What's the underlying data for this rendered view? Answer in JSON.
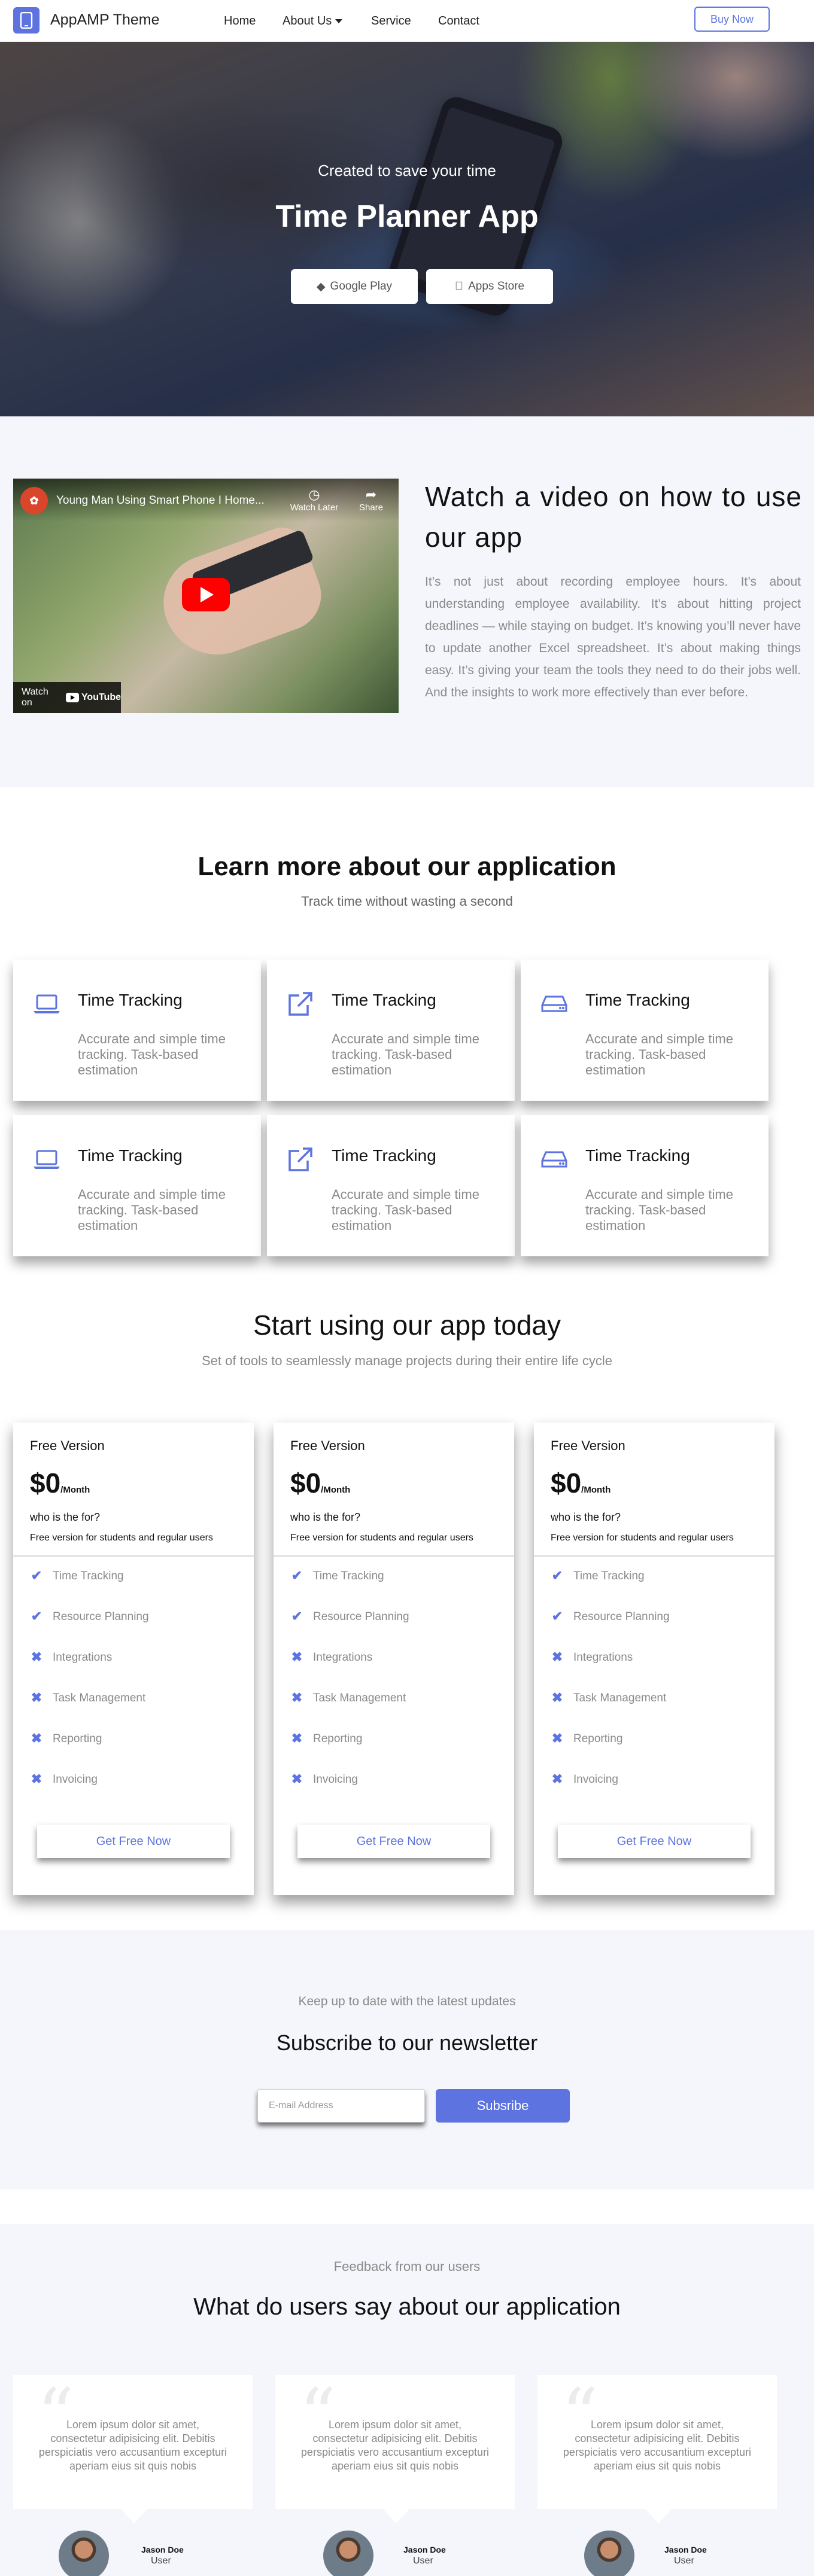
{
  "nav": {
    "logo": "AppAMP Theme",
    "links": [
      "Home",
      "About Us",
      "Service",
      "Contact"
    ],
    "buy": "Buy Now"
  },
  "hero": {
    "subtitle": "Created to save your time",
    "title": "Time Planner App",
    "google_play": "Google Play",
    "apps_store": "Apps Store"
  },
  "video": {
    "yt_title": "Young Man Using Smart Phone I Home...",
    "watch_later": "Watch Later",
    "share": "Share",
    "watch_on": "Watch on",
    "youtube": "YouTube",
    "heading": "Watch a video on how to use our app",
    "text": "It’s not just about recording employee hours. It’s about understanding employee availability. It’s about hitting project deadlines — while staying on budget. It’s knowing you’ll never have to update another Excel spreadsheet. It’s about making things easy. It’s giving your team the tools they need to do their jobs well. And the insights to work more effectively than ever before."
  },
  "learn": {
    "title": "Learn more about our application",
    "subtitle": "Track time without wasting a second",
    "features": [
      {
        "icon": "laptop-icon",
        "title": "Time Tracking",
        "desc": "Accurate and simple time tracking. Task-based estimation"
      },
      {
        "icon": "external-link-icon",
        "title": "Time Tracking",
        "desc": "Accurate and simple time tracking. Task-based estimation"
      },
      {
        "icon": "hard-drive-icon",
        "title": "Time Tracking",
        "desc": "Accurate and simple time tracking. Task-based estimation"
      },
      {
        "icon": "laptop-icon",
        "title": "Time Tracking",
        "desc": "Accurate and simple time tracking. Task-based estimation"
      },
      {
        "icon": "external-link-icon",
        "title": "Time Tracking",
        "desc": "Accurate and simple time tracking. Task-based estimation"
      },
      {
        "icon": "hard-drive-icon",
        "title": "Time Tracking",
        "desc": "Accurate and simple time tracking. Task-based estimation"
      }
    ]
  },
  "pricing": {
    "title": "Start using our app today",
    "subtitle": "Set of tools to seamlessly manage projects during their entire life cycle",
    "cards": [
      {
        "version": "Free Version",
        "price": "$0",
        "period": "/Month",
        "who": "who is the for?",
        "summary": "Free version for students and regular users",
        "items": [
          {
            "label": "Time Tracking",
            "included": true
          },
          {
            "label": "Resource Planning",
            "included": true
          },
          {
            "label": "Integrations",
            "included": false
          },
          {
            "label": "Task Management",
            "included": false
          },
          {
            "label": "Reporting",
            "included": false
          },
          {
            "label": "Invoicing",
            "included": false
          }
        ],
        "button": "Get Free Now"
      },
      {
        "version": "Free Version",
        "price": "$0",
        "period": "/Month",
        "who": "who is the for?",
        "summary": "Free version for students and regular users",
        "items": [
          {
            "label": "Time Tracking",
            "included": true
          },
          {
            "label": "Resource Planning",
            "included": true
          },
          {
            "label": "Integrations",
            "included": false
          },
          {
            "label": "Task Management",
            "included": false
          },
          {
            "label": "Reporting",
            "included": false
          },
          {
            "label": "Invoicing",
            "included": false
          }
        ],
        "button": "Get Free Now"
      },
      {
        "version": "Free Version",
        "price": "$0",
        "period": "/Month",
        "who": "who is the for?",
        "summary": "Free version for students and regular users",
        "items": [
          {
            "label": "Time Tracking",
            "included": true
          },
          {
            "label": "Resource Planning",
            "included": true
          },
          {
            "label": "Integrations",
            "included": false
          },
          {
            "label": "Task Management",
            "included": false
          },
          {
            "label": "Reporting",
            "included": false
          },
          {
            "label": "Invoicing",
            "included": false
          }
        ],
        "button": "Get Free Now"
      }
    ]
  },
  "newsletter": {
    "subtitle": "Keep up to date with the latest updates",
    "title": "Subscribe to our newsletter",
    "placeholder": "E-mail Address",
    "button": "Subsribe"
  },
  "testimonials": {
    "subtitle": "Feedback from our users",
    "title": "What do users say about our application",
    "items": [
      {
        "text": "Lorem ipsum dolor sit amet, consectetur adipisicing elit. Debitis perspiciatis vero accusantium excepturi aperiam eius sit quis nobis",
        "name": "Jason Doe",
        "role": "User"
      },
      {
        "text": "Lorem ipsum dolor sit amet, consectetur adipisicing elit. Debitis perspiciatis vero accusantium excepturi aperiam eius sit quis nobis",
        "name": "Jason Doe",
        "role": "User"
      },
      {
        "text": "Lorem ipsum dolor sit amet, consectetur adipisicing elit. Debitis perspiciatis vero accusantium excepturi aperiam eius sit quis nobis",
        "name": "Jason Doe",
        "role": "User"
      }
    ]
  },
  "colors": {
    "accent": "#5c73e0",
    "section_bg": "#f5f6fc",
    "muted_text": "#8a8a8a"
  }
}
